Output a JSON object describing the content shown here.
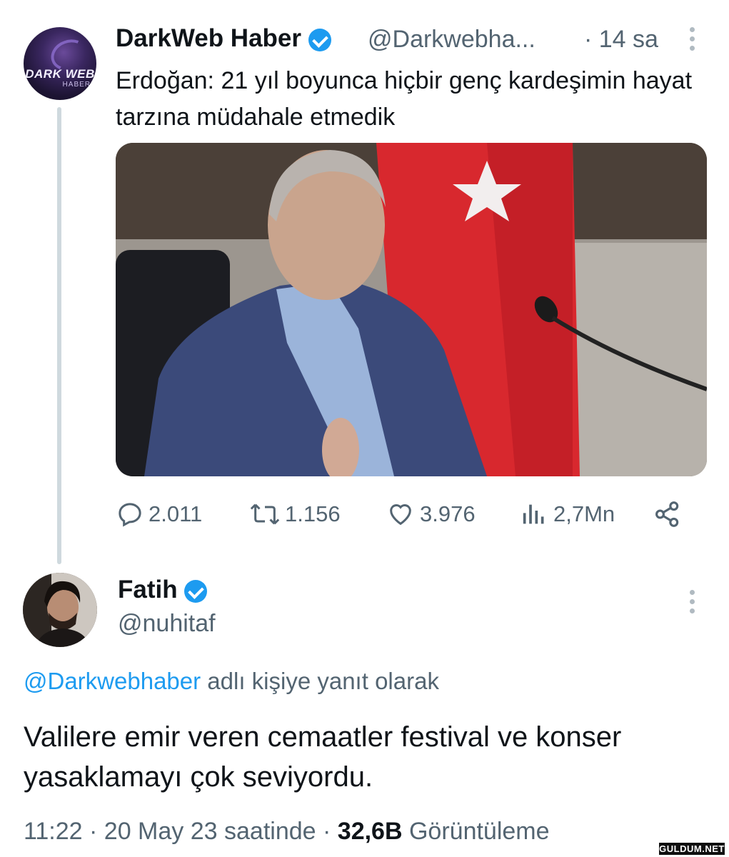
{
  "original_tweet": {
    "author_name": "DarkWeb Haber",
    "handle": "@Darkwebha...",
    "time": "· 14 sa",
    "text": "Erdoğan: 21 yıl boyunca hiçbir genç kardeşimin hayat tarzına müdahale etmedik",
    "avatar_logo_top": "DARK WEB",
    "avatar_logo_bottom": "HABER",
    "stats": {
      "replies": "2.011",
      "retweets": "1.156",
      "likes": "3.976",
      "views": "2,7Mn"
    }
  },
  "reply_tweet": {
    "author_name": "Fatih",
    "handle": "@nuhitaf",
    "reply_to_link": "@Darkwebhaber",
    "reply_to_suffix": " adlı kişiye yanıt olarak",
    "text": "Valilere emir veren cemaatler festival ve konser yasaklamayı çok seviyordu.",
    "time": "11:22",
    "date": "20 May 23 saatinde",
    "views_count": "32,6B",
    "views_label": "Görüntüleme"
  },
  "watermark": "GULDUM.NET",
  "colors": {
    "accent": "#1d9bf0",
    "text": "#0f1419",
    "secondary": "#536471",
    "thread_line": "#cfd9de"
  },
  "icons": [
    "verified-badge-icon",
    "more-icon",
    "reply-icon",
    "retweet-icon",
    "like-icon",
    "views-icon",
    "share-icon"
  ]
}
